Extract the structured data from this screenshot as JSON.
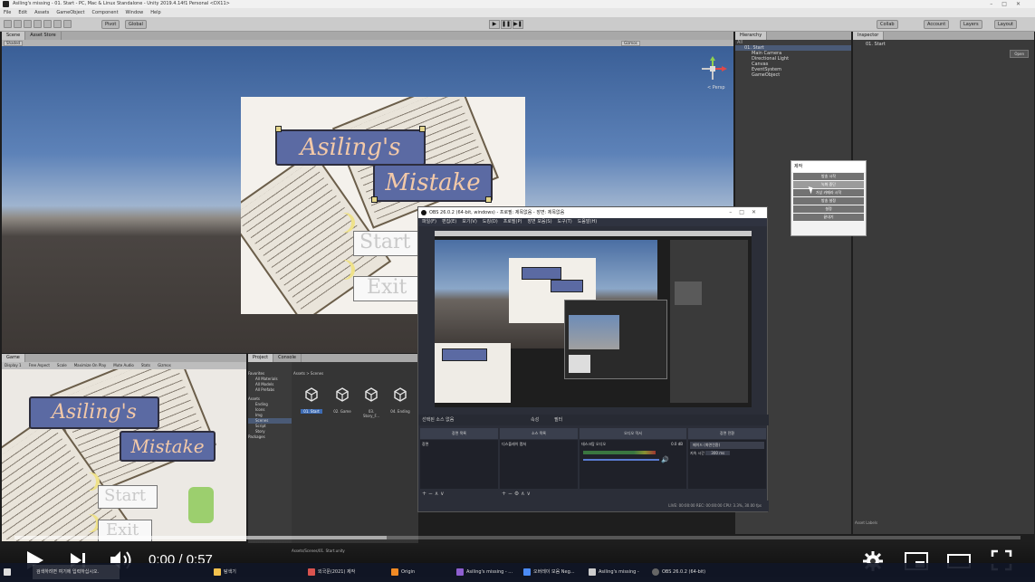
{
  "window": {
    "title": "Asiling's missing - 01. Start - PC, Mac & Linux Standalone - Unity 2019.4.14f1 Personal <DX11>",
    "menu": [
      "File",
      "Edit",
      "Assets",
      "GameObject",
      "Component",
      "Window",
      "Help"
    ]
  },
  "toolbar": {
    "pivot": "Pivot",
    "global": "Global",
    "collab": "Collab",
    "account": "Account",
    "layers": "Layers",
    "layout": "Layout"
  },
  "scene": {
    "tabs": [
      "Scene",
      "Asset Store"
    ],
    "shading": "Shaded",
    "gizmos": "Gizmos",
    "persp": "< Persp"
  },
  "title_card": {
    "line1": "Asiling's",
    "line2": "Mistake",
    "start": "Start",
    "exit": "Exit"
  },
  "hierarchy": {
    "tab": "Hierarchy",
    "search": "All",
    "items": [
      "01. Start",
      "Main Camera",
      "Directional Light",
      "Canvas",
      "EventSystem",
      "GameObject"
    ]
  },
  "inspector": {
    "tab": "Inspector",
    "object": "01. Start",
    "open": "Open",
    "asset_labels": "Asset Labels"
  },
  "context_menu": {
    "header": "제작",
    "items": [
      "방송 시작",
      "녹화 중단",
      "가상 카메라 시작",
      "방송 설정",
      "설정",
      "끝내기"
    ]
  },
  "game": {
    "tabs": [
      "Game"
    ],
    "display": "Display 1",
    "aspect": "Free Aspect",
    "scale": "Scale",
    "maximize": "Maximize On Play",
    "mute": "Mute Audio",
    "stats": "Stats",
    "gizmos": "Gizmos"
  },
  "project": {
    "tabs": [
      "Project",
      "Console"
    ],
    "favorites": "Favorites",
    "fav_items": [
      "All Materials",
      "All Models",
      "All Prefabs"
    ],
    "assets": "Assets",
    "asset_folders": [
      "Ending",
      "Icons",
      "Img",
      "Scenes",
      "Script",
      "Story"
    ],
    "packages": "Packages",
    "breadcrumb": "Assets > Scenes",
    "scenes": [
      "01. Start",
      "02. Game",
      "03. Story_F...",
      "04. Ending"
    ],
    "path": "Assets/Scenes/01. Start.unity"
  },
  "obs": {
    "title": "OBS 26.0.2 (64-bit, windows) - 프로필: 제목없음 - 장면: 제목없음",
    "menu": [
      "파일(F)",
      "편집(E)",
      "보기(V)",
      "도킹(D)",
      "프로필(P)",
      "장면 모음(S)",
      "도구(T)",
      "도움말(H)"
    ],
    "scene_bar": "선택된 소스 없음",
    "properties": "속성",
    "filters": "필터",
    "docks": [
      "장면 목록",
      "소스 목록",
      "오디오 믹서",
      "장면 전환"
    ],
    "scene_item": "장면",
    "source_item": "디스플레이 캡쳐",
    "mixer_item": "데스크탑 오디오",
    "mixer_db": "0.0 dB",
    "transition": "페이드 (화면전환)",
    "duration_label": "지속 시간",
    "duration": "300 ms",
    "status": "LIVE: 00:00:00   REC: 00:00:00   CPU: 3.3%, 30.00 fps"
  },
  "player": {
    "time": "0:00 / 0:57",
    "progress": 0.0,
    "buffered": 0.37
  },
  "taskbar": {
    "search": "검색하려면 여기에 입력하십시오.",
    "apps": [
      "탐색기",
      "외국문(2021) 제작",
      "Origin",
      "Asiling's missing - ...",
      "오버레이 모음 Neg...",
      "Asiling's missing -",
      "OBS 26.0.2 (64-bit)"
    ]
  }
}
